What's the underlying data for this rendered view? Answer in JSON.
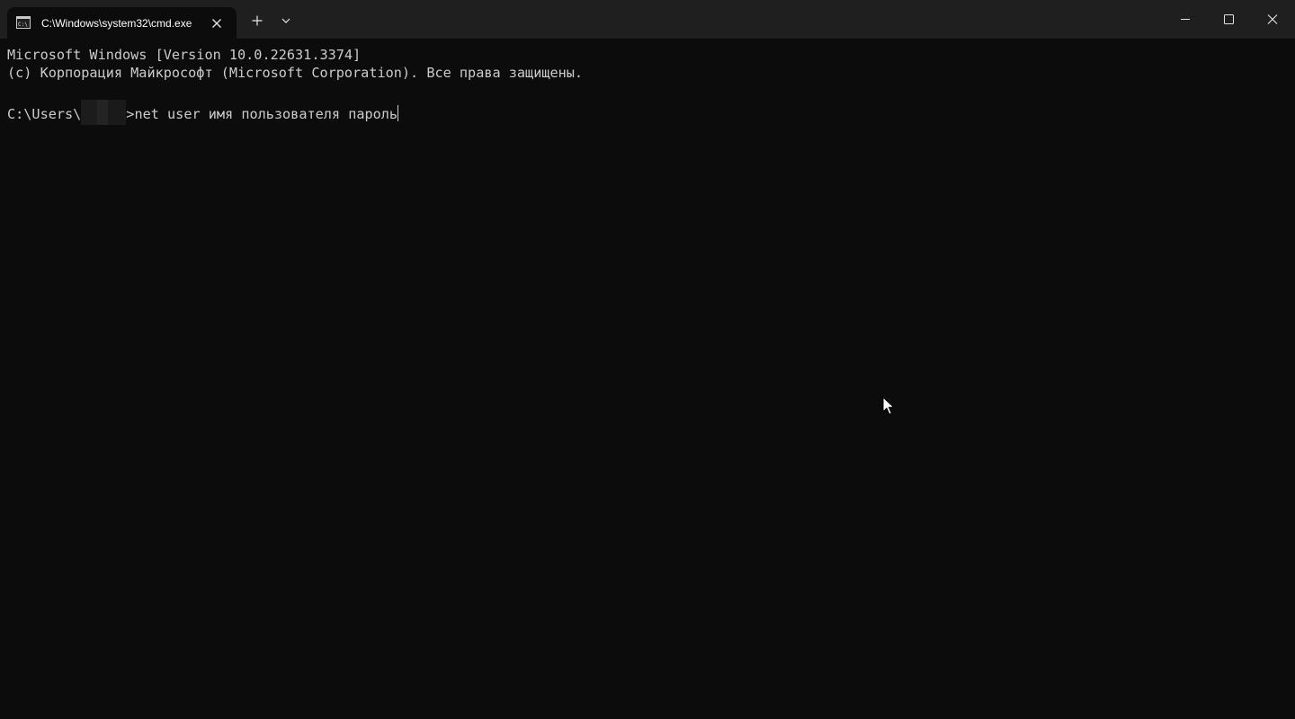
{
  "tab": {
    "title": "C:\\Windows\\system32\\cmd.exe",
    "icon": "cmd-icon"
  },
  "toolbar": {
    "new_tab_icon": "plus-icon",
    "dropdown_icon": "chevron-down-icon"
  },
  "window_controls": {
    "minimize_icon": "minimize-icon",
    "maximize_icon": "maximize-icon",
    "close_icon": "close-icon"
  },
  "console": {
    "line1": "Microsoft Windows [Version 10.0.22631.3374]",
    "line2": "(c) Корпорация Майкрософт (Microsoft Corporation). Все права защищены.",
    "prompt_prefix": "C:\\Users\\",
    "prompt_suffix": ">",
    "command": "net user имя пользователя пароль"
  },
  "colors": {
    "titlebar_bg": "#1f1f1f",
    "console_bg": "#0c0c0c",
    "console_text": "#cccccc",
    "tab_text": "#ffffff"
  }
}
